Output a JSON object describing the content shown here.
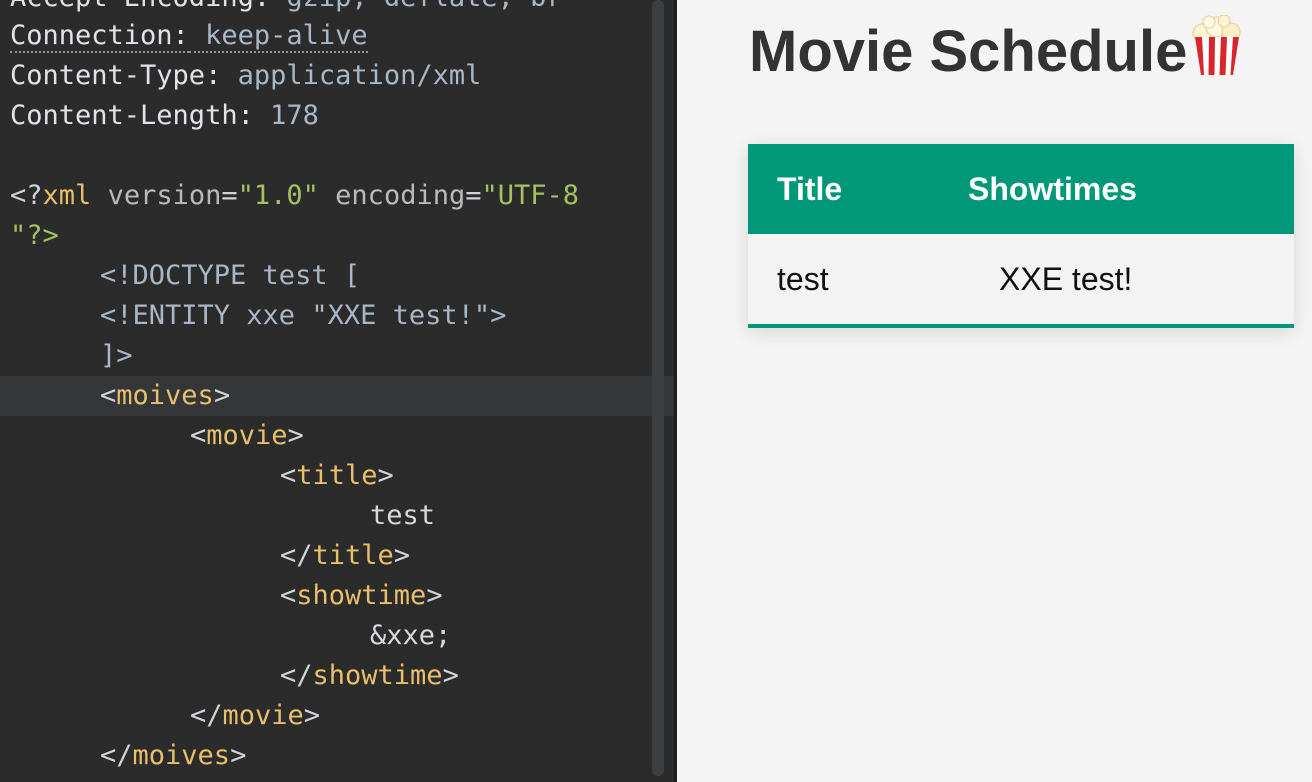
{
  "editor": {
    "header_top": {
      "name": "Accept-Encoding:",
      "value": " gzip, deflate, br"
    },
    "headers": [
      {
        "name": "Connection:",
        "value": " keep-alive"
      },
      {
        "name": "Content-Type:",
        "value": " application/xml"
      },
      {
        "name": "Content-Length:",
        "value": " 178"
      }
    ],
    "xml_decl": {
      "open": "<?",
      "tag": "xml",
      "attr1": "version",
      "eq": "=",
      "val1": "\"1.0\"",
      "attr2": "encoding",
      "val2": "\"UTF-8",
      "cont": "\"?>"
    },
    "doctype": [
      "<!DOCTYPE test [",
      "<!ENTITY xxe \"XXE test!\">",
      "]>"
    ],
    "tags": {
      "moives": "moives",
      "movie": "movie",
      "title": "title",
      "showtime": "showtime",
      "lt": "<",
      "gt": ">",
      "lt_close": "</"
    },
    "title_text": "test",
    "showtime_text": "&xxe;"
  },
  "preview": {
    "title": "Movie Schedule",
    "title_icon": "popcorn-icon",
    "table": {
      "headers": [
        "Title",
        "Showtimes"
      ],
      "rows": [
        {
          "title": "test",
          "showtimes": "XXE test!"
        }
      ]
    },
    "accent_color": "#009879"
  }
}
